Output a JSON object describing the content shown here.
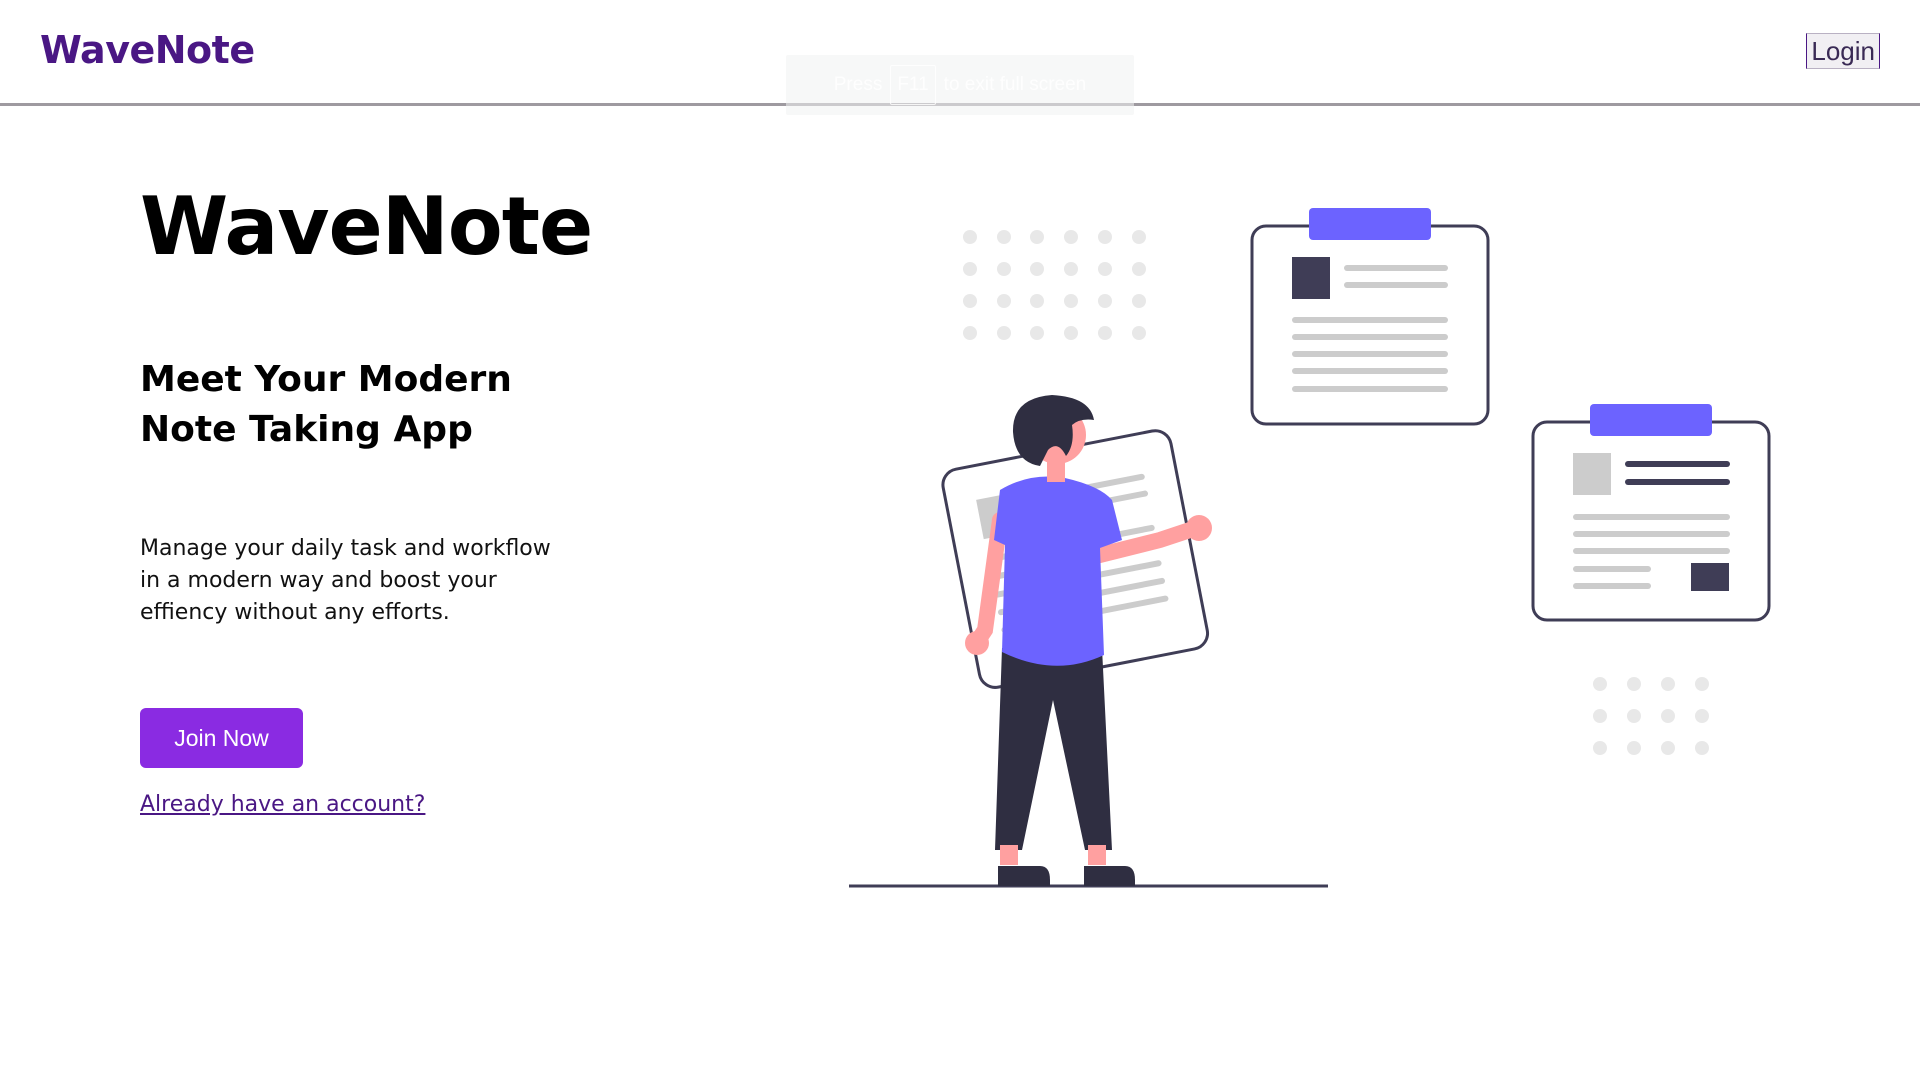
{
  "header": {
    "brand": "WaveNote",
    "login_label": "Login"
  },
  "fullscreen_toast": {
    "prefix": "Press",
    "key": "F11",
    "suffix": "to exit full screen"
  },
  "hero": {
    "title": "WaveNote",
    "subtitle": "Meet Your Modern Note Taking App",
    "description": "Manage your daily task and workflow in a modern way and boost your effiency without any efforts.",
    "join_label": "Join Now",
    "account_link": "Already have an account?"
  },
  "colors": {
    "brand": "#4a1784",
    "accent": "#8a2be2",
    "illustration_primary": "#6c63ff",
    "illustration_dark": "#3f3d56"
  },
  "icons": {
    "illustration": "person-with-notes-illustration"
  }
}
